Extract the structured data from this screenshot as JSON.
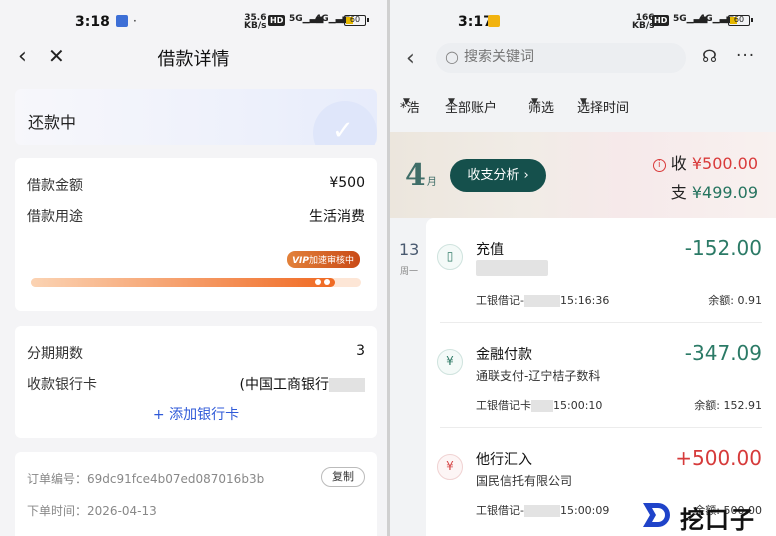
{
  "left": {
    "status_bar": {
      "time": "3:18",
      "net_rate": "35.6",
      "net_unit": "KB/s",
      "hd": "HD",
      "sig1": "5G",
      "sig2": "4G",
      "battery": "60"
    },
    "nav": {
      "title": "借款详情"
    },
    "status": {
      "text": "还款中"
    },
    "loan": {
      "amount_label": "借款金额",
      "amount_value": "¥500",
      "purpose_label": "借款用途",
      "purpose_value": "生活消费",
      "vip_prefix": "VIP",
      "vip_text": "加速审核中",
      "progress": 0.92
    },
    "term": {
      "installments_label": "分期期数",
      "installments_value": "3",
      "bank_label": "收款银行卡",
      "bank_value": "(中国工商银行",
      "add_bank": "添加银行卡"
    },
    "order": {
      "number_label": "订单编号",
      "number_value": "69dc91fce4b07ed087016b3b",
      "copy": "复制",
      "time_label": "下单时间",
      "time_value": "2026-04-13"
    }
  },
  "right": {
    "status_bar": {
      "time": "3:17",
      "net_rate": "166",
      "net_unit": "KB/s",
      "hd": "HD",
      "sig1": "5G",
      "sig2": "4G",
      "battery": "60"
    },
    "search": {
      "placeholder": "搜索关键词"
    },
    "filters": [
      "*浩",
      "全部账户",
      "筛选",
      "选择时间"
    ],
    "month": {
      "number": "4",
      "suffix": "月",
      "analysis": "收支分析",
      "income_label": "收",
      "income_value": "¥500.00",
      "expense_label": "支",
      "expense_value": "¥499.09"
    },
    "date": {
      "day": "13",
      "weekday": "周一"
    },
    "transactions": [
      {
        "name": "充值",
        "sub": "",
        "amount": "-152.00",
        "account": "工银借记-",
        "time": "15:16:36",
        "balance": "余额: 0.91"
      },
      {
        "name": "金融付款",
        "sub": "通联支付-辽宁桔子数科",
        "amount": "-347.09",
        "account": "工银借记卡",
        "time": "15:00:10",
        "balance": "余额: 152.91"
      },
      {
        "name": "他行汇入",
        "sub": "国民信托有限公司",
        "amount": "+500.00",
        "account": "工银借记-",
        "time": "15:00:09",
        "balance": "余额: 500.00"
      }
    ]
  },
  "watermark": {
    "text": "挖口子"
  },
  "colors": {
    "expense_green": "#2b7a66",
    "income_red": "#d63a3a",
    "accent_blue": "#2f5ad8",
    "dark_teal": "#15504c",
    "vip_orange": "#e2813a"
  }
}
